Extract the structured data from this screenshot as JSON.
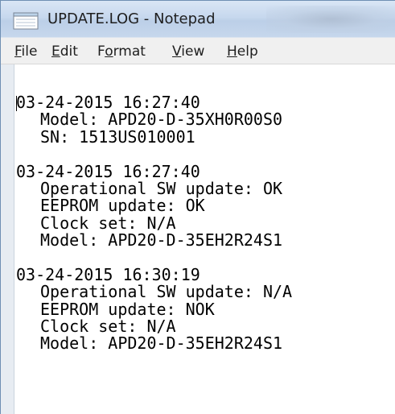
{
  "window": {
    "title": "UPDATE.LOG - Notepad",
    "icon": "notepad-icon"
  },
  "menu": {
    "file": {
      "hotkey": "F",
      "rest": "ile"
    },
    "edit": {
      "hotkey": "E",
      "rest": "dit"
    },
    "format": {
      "pre": "F",
      "hotkey": "o",
      "rest": "rmat"
    },
    "view": {
      "hotkey": "V",
      "rest": "iew"
    },
    "help": {
      "hotkey": "H",
      "rest": "elp"
    }
  },
  "log": [
    {
      "text": "03-24-2015 16:27:40",
      "indent": false
    },
    {
      "text": "Model: APD20-D-35XH0R00S0",
      "indent": true
    },
    {
      "text": "SN: 1513US010001",
      "indent": true
    },
    {
      "text": "",
      "indent": false
    },
    {
      "text": "03-24-2015 16:27:40",
      "indent": false
    },
    {
      "text": "Operational SW update: OK",
      "indent": true
    },
    {
      "text": "EEPROM update: OK",
      "indent": true
    },
    {
      "text": "Clock set: N/A",
      "indent": true
    },
    {
      "text": "Model: APD20-D-35EH2R24S1",
      "indent": true
    },
    {
      "text": "",
      "indent": false
    },
    {
      "text": "03-24-2015 16:30:19",
      "indent": false
    },
    {
      "text": "Operational SW update: N/A",
      "indent": true
    },
    {
      "text": "EEPROM update: NOK",
      "indent": true
    },
    {
      "text": "Clock set: N/A",
      "indent": true
    },
    {
      "text": "Model: APD20-D-35EH2R24S1",
      "indent": true
    }
  ]
}
